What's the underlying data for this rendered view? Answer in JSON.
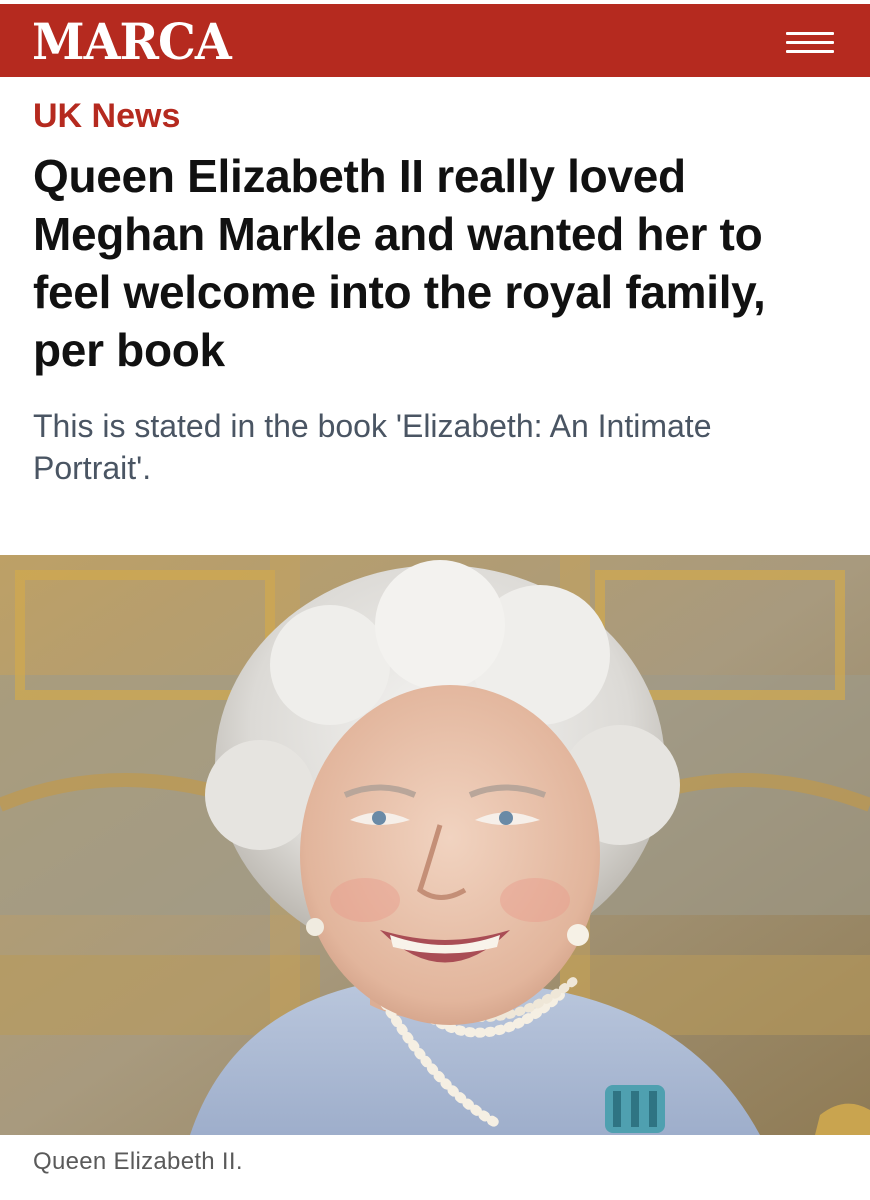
{
  "header": {
    "logo_text": "MARCA",
    "menu_icon": "hamburger-menu-icon",
    "brand_color": "#b52a1f"
  },
  "article": {
    "section": "UK News",
    "headline": "Queen Elizabeth II really loved Meghan Markle and wanted her to feel welcome into the royal family, per book",
    "subtitle": "This is stated in the book 'Elizabeth: An Intimate Portrait'.",
    "photo": {
      "subject": "portrait of smiling elderly woman with white hair, pearl necklace and light blue dress, gilded room background"
    },
    "caption": "Queen Elizabeth II."
  }
}
